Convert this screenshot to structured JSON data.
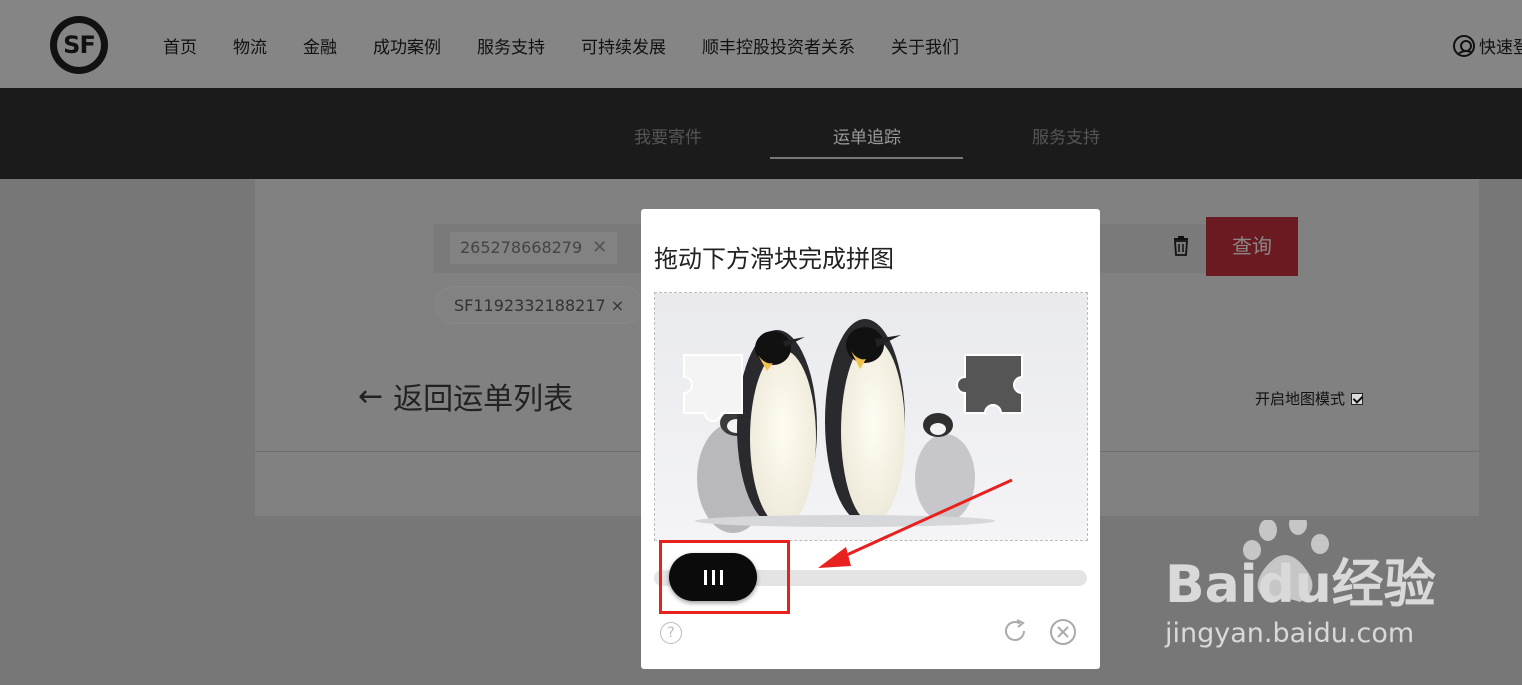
{
  "header": {
    "logo_text": "SF",
    "nav": [
      "首页",
      "物流",
      "金融",
      "成功案例",
      "服务支持",
      "可持续发展",
      "顺丰控股投资者关系",
      "关于我们"
    ],
    "login_label": "快速登"
  },
  "subnav": {
    "tabs": [
      "我要寄件",
      "运单追踪",
      "服务支持"
    ],
    "active": "运单追踪"
  },
  "search": {
    "waybill_chip": "265278668279",
    "query_button": "查询",
    "history_chip": "SF1192332188217 ×"
  },
  "tracking": {
    "back_label": "返回运单列表",
    "map_mode_label": "开启地图模式",
    "map_mode_checked": true
  },
  "captcha": {
    "title": "拖动下方滑块完成拼图",
    "slider_progress": 0.0,
    "help_icon": "help-icon",
    "refresh_icon": "refresh-icon",
    "close_icon": "close-icon"
  },
  "watermark": {
    "brand": "Baidu经验",
    "url": "jingyan.baidu.com"
  },
  "colors": {
    "brand_red": "#c8202e",
    "annotation_red": "#e8211f",
    "knob": "#0b0b0b"
  }
}
